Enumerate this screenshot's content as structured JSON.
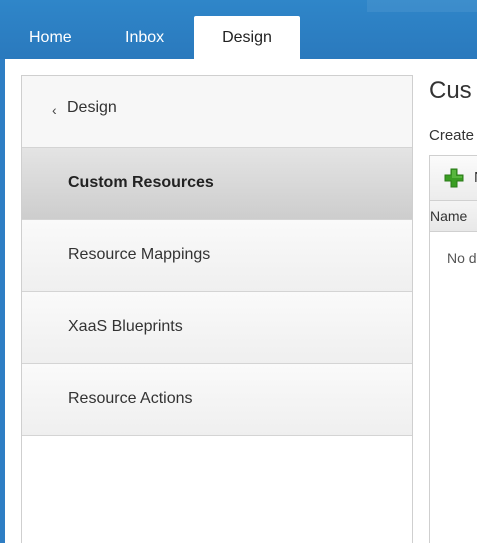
{
  "tabs": [
    {
      "label": "Home"
    },
    {
      "label": "Inbox"
    },
    {
      "label": "Design",
      "active": true
    }
  ],
  "sidebar": {
    "back": {
      "icon": "chevron-left-icon",
      "label": "Design"
    },
    "items": [
      {
        "label": "Custom Resources",
        "selected": true
      },
      {
        "label": "Resource Mappings"
      },
      {
        "label": "XaaS Blueprints"
      },
      {
        "label": "Resource Actions"
      }
    ]
  },
  "main": {
    "title": "Cus",
    "subtitle": "Create",
    "toolbar": {
      "icon": "add-icon",
      "label_truncated": "N"
    },
    "grid_header": {
      "name_col": "Name"
    },
    "empty_text": "No d"
  },
  "colors": {
    "brand_blue": "#2e7ec4",
    "add_green": "#3a9d23"
  }
}
